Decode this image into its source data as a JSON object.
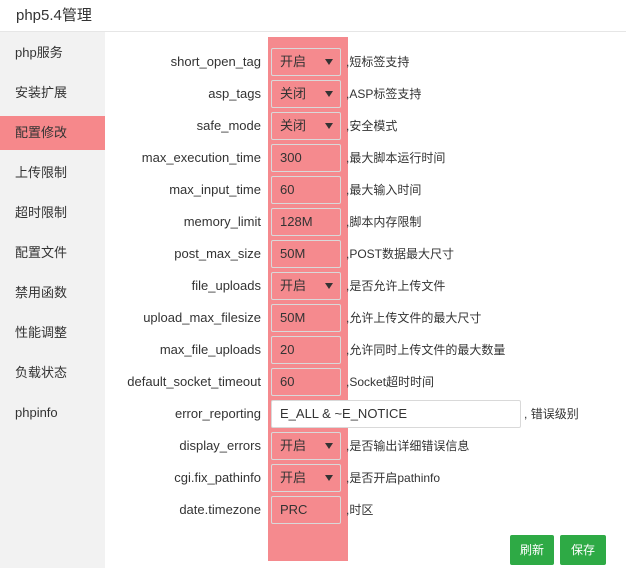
{
  "window": {
    "title": "php5.4管理"
  },
  "sidebar": {
    "items": [
      {
        "label": "php服务"
      },
      {
        "label": "安装扩展"
      },
      {
        "label": "配置修改"
      },
      {
        "label": "上传限制"
      },
      {
        "label": "超时限制"
      },
      {
        "label": "配置文件"
      },
      {
        "label": "禁用函数"
      },
      {
        "label": "性能调整"
      },
      {
        "label": "负载状态"
      },
      {
        "label": "phpinfo"
      }
    ],
    "active_index": 2
  },
  "config": {
    "rows": [
      {
        "label": "short_open_tag",
        "value": "开启",
        "type": "select",
        "desc": "短标签支持"
      },
      {
        "label": "asp_tags",
        "value": "关闭",
        "type": "select",
        "desc": "ASP标签支持"
      },
      {
        "label": "safe_mode",
        "value": "关闭",
        "type": "select",
        "desc": "安全模式"
      },
      {
        "label": "max_execution_time",
        "value": "300",
        "type": "input",
        "desc": "最大脚本运行时间"
      },
      {
        "label": "max_input_time",
        "value": "60",
        "type": "input",
        "desc": "最大输入时间"
      },
      {
        "label": "memory_limit",
        "value": "128M",
        "type": "input",
        "desc": "脚本内存限制"
      },
      {
        "label": "post_max_size",
        "value": "50M",
        "type": "input",
        "desc": "POST数据最大尺寸"
      },
      {
        "label": "file_uploads",
        "value": "开启",
        "type": "select",
        "desc": "是否允许上传文件"
      },
      {
        "label": "upload_max_filesize",
        "value": "50M",
        "type": "input",
        "desc": "允许上传文件的最大尺寸"
      },
      {
        "label": "max_file_uploads",
        "value": "20",
        "type": "input",
        "desc": "允许同时上传文件的最大数量"
      },
      {
        "label": "default_socket_timeout",
        "value": "60",
        "type": "input",
        "desc": "Socket超时时间"
      },
      {
        "label": "error_reporting",
        "value": "E_ALL & ~E_NOTICE",
        "type": "wide",
        "desc": "错误级别"
      },
      {
        "label": "display_errors",
        "value": "开启",
        "type": "select",
        "desc": "是否输出详细错误信息"
      },
      {
        "label": "cgi.fix_pathinfo",
        "value": "开启",
        "type": "select",
        "desc": "是否开启pathinfo"
      },
      {
        "label": "date.timezone",
        "value": "PRC",
        "type": "input",
        "desc": "时区"
      }
    ],
    "desc_separator": ","
  },
  "actions": {
    "refresh_label": "刷新",
    "save_label": "保存"
  },
  "colors": {
    "highlight": "#f58a8e",
    "active_sidebar": "#f6888b",
    "button_green": "#2eaa45"
  }
}
